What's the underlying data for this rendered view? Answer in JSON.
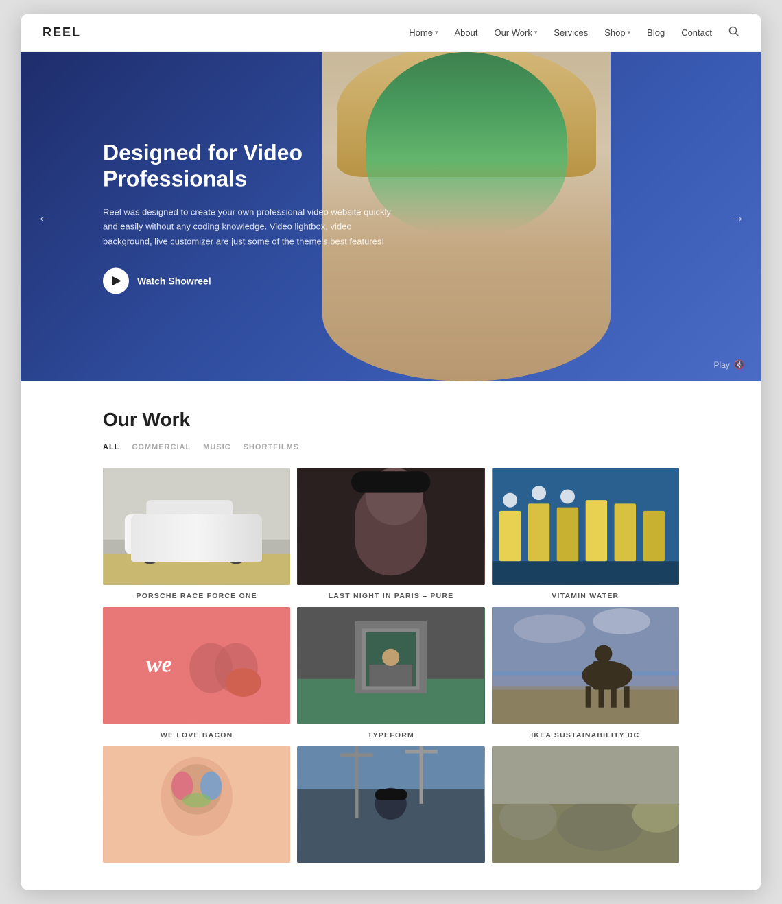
{
  "header": {
    "logo": "REEL",
    "nav": [
      {
        "label": "Home",
        "hasDropdown": true
      },
      {
        "label": "About",
        "hasDropdown": false
      },
      {
        "label": "Our Work",
        "hasDropdown": true
      },
      {
        "label": "Services",
        "hasDropdown": false
      },
      {
        "label": "Shop",
        "hasDropdown": true
      },
      {
        "label": "Blog",
        "hasDropdown": false
      },
      {
        "label": "Contact",
        "hasDropdown": false
      }
    ]
  },
  "hero": {
    "title": "Designed for Video Professionals",
    "description": "Reel was designed to create your own professional video website quickly and easily without any coding knowledge. Video lightbox, video background, live customizer are just some of the theme's best features!",
    "cta_label": "Watch Showreel",
    "play_label": "Play"
  },
  "ourWork": {
    "section_title": "Our Work",
    "filters": [
      {
        "label": "ALL",
        "active": true
      },
      {
        "label": "COMMERCIAL",
        "active": false
      },
      {
        "label": "MUSIC",
        "active": false
      },
      {
        "label": "SHORTFILMS",
        "active": false
      }
    ],
    "items": [
      {
        "label": "PORSCHE RACE FORCE ONE",
        "thumb_class": "work-thumb-car"
      },
      {
        "label": "LAST NIGHT IN PARIS – PURE",
        "thumb_class": "work-thumb-portrait"
      },
      {
        "label": "VITAMIN WATER",
        "thumb_class": "work-thumb-gym"
      },
      {
        "label": "WE LOVE BACON",
        "thumb_class": "work-thumb-pink",
        "text": "we"
      },
      {
        "label": "TYPEFORM",
        "thumb_class": "work-thumb-room"
      },
      {
        "label": "IKEA SUSTAINABILITY DC",
        "thumb_class": "work-thumb-horse"
      },
      {
        "label": "",
        "thumb_class": "work-thumb-row3a"
      },
      {
        "label": "",
        "thumb_class": "work-thumb-row3b"
      },
      {
        "label": "",
        "thumb_class": "work-thumb-row3c"
      }
    ]
  }
}
